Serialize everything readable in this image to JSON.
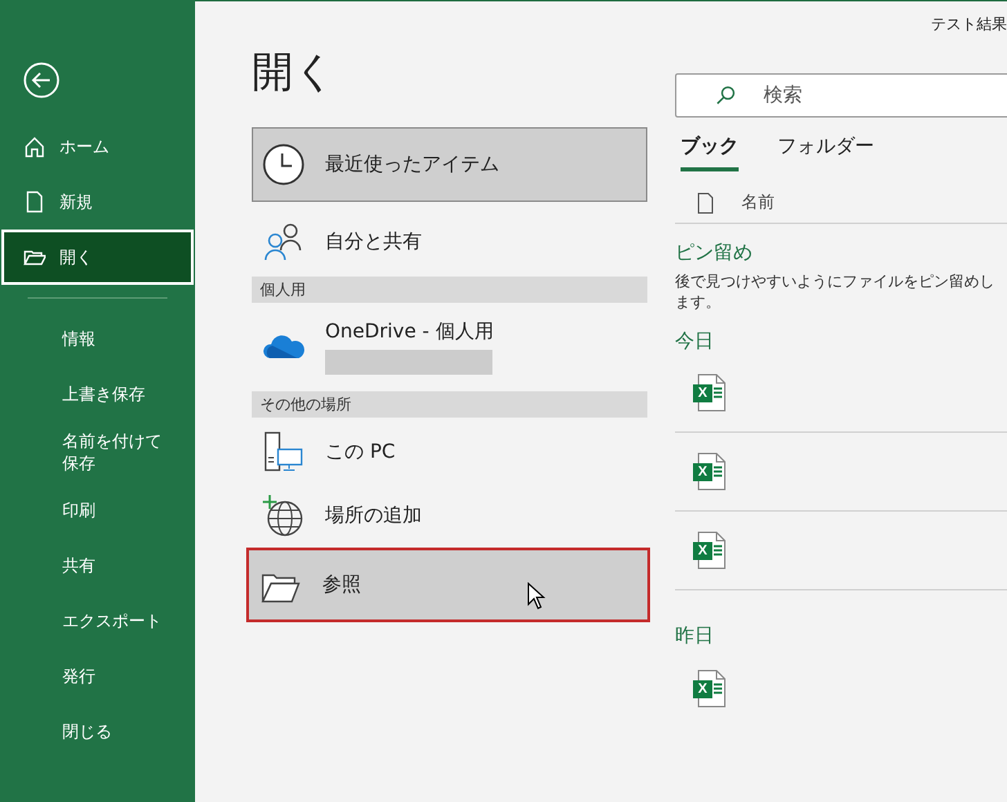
{
  "window": {
    "title": "テスト結果"
  },
  "sidebar": {
    "items": [
      {
        "label": "ホーム",
        "selected": false,
        "kind": "icon"
      },
      {
        "label": "新規",
        "selected": false,
        "kind": "icon"
      },
      {
        "label": "開く",
        "selected": true,
        "kind": "icon"
      },
      {
        "kind": "divider"
      },
      {
        "label": "情報",
        "selected": false,
        "kind": "text"
      },
      {
        "label": "上書き保存",
        "selected": false,
        "kind": "text"
      },
      {
        "label": "名前を付けて保存",
        "selected": false,
        "kind": "text"
      },
      {
        "label": "印刷",
        "selected": false,
        "kind": "text"
      },
      {
        "label": "共有",
        "selected": false,
        "kind": "text"
      },
      {
        "label": "エクスポート",
        "selected": false,
        "kind": "text"
      },
      {
        "label": "発行",
        "selected": false,
        "kind": "text"
      },
      {
        "label": "閉じる",
        "selected": false,
        "kind": "text"
      }
    ]
  },
  "page_title": "開く",
  "locations": [
    {
      "kind": "item",
      "label": "最近使ったアイテム",
      "selected": true,
      "highlighted": false
    },
    {
      "kind": "item",
      "label": "自分と共有",
      "selected": false,
      "highlighted": false
    },
    {
      "kind": "header",
      "label": "個人用"
    },
    {
      "kind": "account",
      "label": "OneDrive - 個人用",
      "selected": false,
      "highlighted": false
    },
    {
      "kind": "header",
      "label": "その他の場所"
    },
    {
      "kind": "item",
      "label": "この PC",
      "selected": false,
      "highlighted": false
    },
    {
      "kind": "item",
      "label": "場所の追加",
      "selected": false,
      "highlighted": false
    },
    {
      "kind": "item",
      "label": "参照",
      "selected": false,
      "highlighted": true
    }
  ],
  "search": {
    "placeholder": "検索"
  },
  "tabs": [
    {
      "label": "ブック",
      "selected": true
    },
    {
      "label": "フォルダー",
      "selected": false
    }
  ],
  "file_list": {
    "column": "名前",
    "sections": [
      {
        "title": "ピン留め",
        "description": "後で見つけやすいようにファイルをピン留めします。"
      },
      {
        "title": "今日",
        "files": [
          {
            "kind": "xlsx",
            "badge": "X"
          },
          {
            "kind": "xlsx",
            "badge": "X"
          },
          {
            "kind": "xlsx",
            "badge": "X"
          }
        ]
      },
      {
        "title": "昨日",
        "files": [
          {
            "kind": "xlsx",
            "badge": "X"
          }
        ]
      }
    ]
  }
}
